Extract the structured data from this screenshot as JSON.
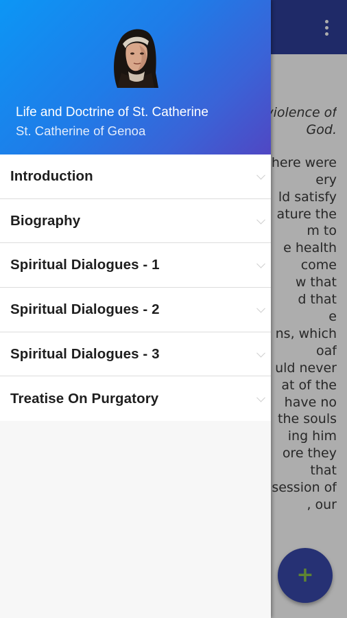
{
  "background_content": {
    "lines": [
      "violence of",
      "God.",
      "here were",
      "ery",
      "ld satisfy",
      "ature the",
      "m to",
      "e health",
      "come",
      "w that",
      "d that",
      "e",
      "ns, which",
      "oaf",
      "uld never",
      "at of the",
      "have no",
      "the souls",
      "ing him",
      "ore they",
      "that",
      "session of",
      ", our"
    ]
  },
  "fab": {
    "icon": "+"
  },
  "drawer": {
    "header": {
      "title": "Life and Doctrine of St. Catherine",
      "subtitle": "St. Catherine of Genoa"
    },
    "menu": [
      {
        "label": "Introduction"
      },
      {
        "label": "Biography"
      },
      {
        "label": "Spiritual Dialogues - 1"
      },
      {
        "label": "Spiritual Dialogues - 2"
      },
      {
        "label": "Spiritual Dialogues - 3"
      },
      {
        "label": "Treatise On Purgatory"
      }
    ]
  },
  "colors": {
    "app_bar": "#2e3f9a",
    "fab": "#3949ab",
    "fab_icon": "#8bc34a",
    "header_gradient_start": "#0c96f5",
    "header_gradient_end": "#5047c3"
  }
}
